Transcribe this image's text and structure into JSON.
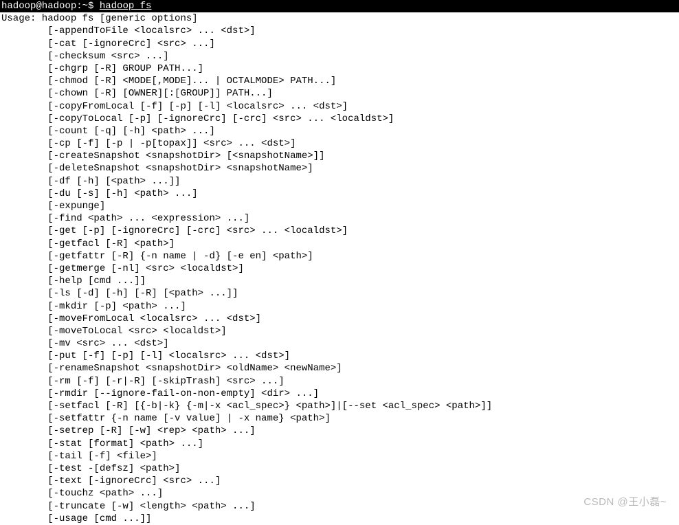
{
  "prompt": {
    "user_host": "hadoop@hadoop",
    "path": "~",
    "symbol": "$",
    "command": "hadoop fs"
  },
  "usage_line": "Usage: hadoop fs [generic options]",
  "options": [
    "[-appendToFile <localsrc> ... <dst>]",
    "[-cat [-ignoreCrc] <src> ...]",
    "[-checksum <src> ...]",
    "[-chgrp [-R] GROUP PATH...]",
    "[-chmod [-R] <MODE[,MODE]... | OCTALMODE> PATH...]",
    "[-chown [-R] [OWNER][:[GROUP]] PATH...]",
    "[-copyFromLocal [-f] [-p] [-l] <localsrc> ... <dst>]",
    "[-copyToLocal [-p] [-ignoreCrc] [-crc] <src> ... <localdst>]",
    "[-count [-q] [-h] <path> ...]",
    "[-cp [-f] [-p | -p[topax]] <src> ... <dst>]",
    "[-createSnapshot <snapshotDir> [<snapshotName>]]",
    "[-deleteSnapshot <snapshotDir> <snapshotName>]",
    "[-df [-h] [<path> ...]]",
    "[-du [-s] [-h] <path> ...]",
    "[-expunge]",
    "[-find <path> ... <expression> ...]",
    "[-get [-p] [-ignoreCrc] [-crc] <src> ... <localdst>]",
    "[-getfacl [-R] <path>]",
    "[-getfattr [-R] {-n name | -d} [-e en] <path>]",
    "[-getmerge [-nl] <src> <localdst>]",
    "[-help [cmd ...]]",
    "[-ls [-d] [-h] [-R] [<path> ...]]",
    "[-mkdir [-p] <path> ...]",
    "[-moveFromLocal <localsrc> ... <dst>]",
    "[-moveToLocal <src> <localdst>]",
    "[-mv <src> ... <dst>]",
    "[-put [-f] [-p] [-l] <localsrc> ... <dst>]",
    "[-renameSnapshot <snapshotDir> <oldName> <newName>]",
    "[-rm [-f] [-r|-R] [-skipTrash] <src> ...]",
    "[-rmdir [--ignore-fail-on-non-empty] <dir> ...]",
    "[-setfacl [-R] [{-b|-k} {-m|-x <acl_spec>} <path>]|[--set <acl_spec> <path>]]",
    "[-setfattr {-n name [-v value] | -x name} <path>]",
    "[-setrep [-R] [-w] <rep> <path> ...]",
    "[-stat [format] <path> ...]",
    "[-tail [-f] <file>]",
    "[-test -[defsz] <path>]",
    "[-text [-ignoreCrc] <src> ...]",
    "[-touchz <path> ...]",
    "[-truncate [-w] <length> <path> ...]",
    "[-usage [cmd ...]]"
  ],
  "watermark": "CSDN @王小磊~"
}
